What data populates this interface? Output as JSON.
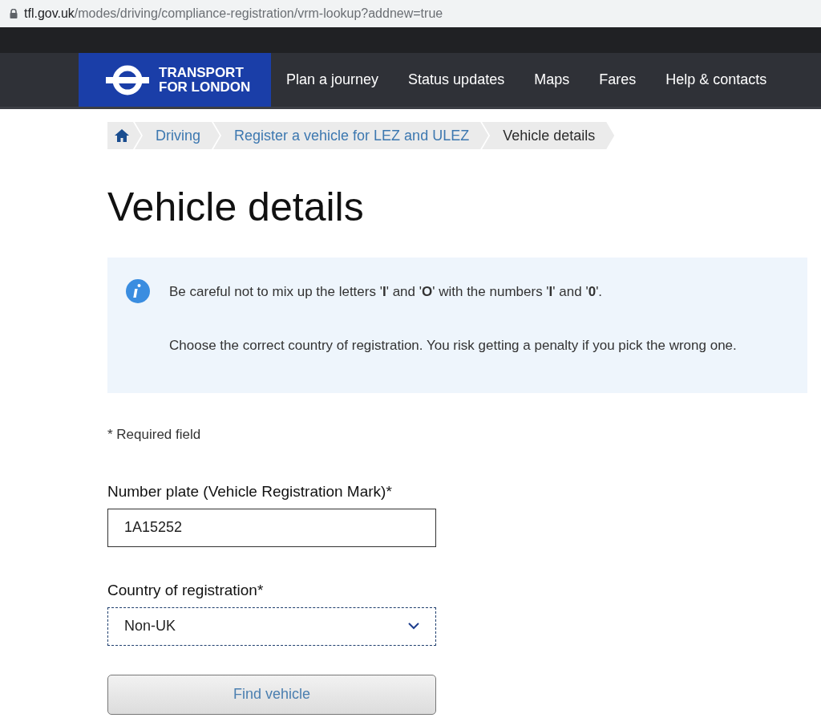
{
  "address_bar": {
    "host": "tfl.gov.uk",
    "path": "/modes/driving/compliance-registration/vrm-lookup?addnew=true"
  },
  "header": {
    "logo_lines": [
      "TRANSPORT",
      "FOR LONDON"
    ],
    "nav": [
      "Plan a journey",
      "Status updates",
      "Maps",
      "Fares",
      "Help & contacts"
    ]
  },
  "breadcrumb": [
    {
      "label": "Driving",
      "current": false
    },
    {
      "label": "Register a vehicle for LEZ and ULEZ",
      "current": false
    },
    {
      "label": "Vehicle details",
      "current": true
    }
  ],
  "heading": "Vehicle details",
  "info": [
    "Be careful not to mix up the letters '**I**' and '**O**' with the numbers '**I**' and '**0**'.",
    "Choose the correct country of registration. You risk getting a penalty if you pick the wrong one."
  ],
  "required_note": "* Required field",
  "fields": [
    {
      "kind": "text",
      "label": "Number plate (Vehicle Registration Mark)*",
      "value": "1A15252"
    },
    {
      "kind": "select",
      "label": "Country of registration*",
      "value": "Non-UK"
    }
  ],
  "submit": "Find vehicle"
}
